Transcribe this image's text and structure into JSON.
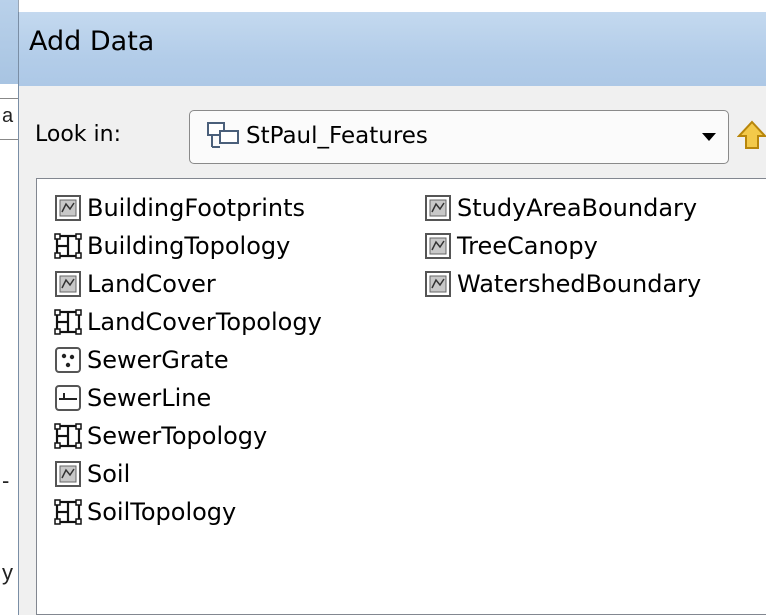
{
  "background_window": {
    "fragment_top": "a",
    "fragment_mid": "-",
    "fragment_bottom": "y"
  },
  "dialog": {
    "title": "Add Data",
    "look_in_label": "Look in:",
    "look_in_value": "StPaul_Features",
    "look_in_icon": "feature-dataset-icon"
  },
  "items": [
    {
      "label": "BuildingFootprints",
      "icon": "polygon-feature-class-icon"
    },
    {
      "label": "BuildingTopology",
      "icon": "topology-icon"
    },
    {
      "label": "LandCover",
      "icon": "polygon-feature-class-icon"
    },
    {
      "label": "LandCoverTopology",
      "icon": "topology-icon"
    },
    {
      "label": "SewerGrate",
      "icon": "point-feature-class-icon"
    },
    {
      "label": "SewerLine",
      "icon": "line-feature-class-icon"
    },
    {
      "label": "SewerTopology",
      "icon": "topology-icon"
    },
    {
      "label": "Soil",
      "icon": "polygon-feature-class-icon"
    },
    {
      "label": "SoilTopology",
      "icon": "topology-icon"
    },
    {
      "label": "StudyAreaBoundary",
      "icon": "polygon-feature-class-icon"
    },
    {
      "label": "TreeCanopy",
      "icon": "polygon-feature-class-icon"
    },
    {
      "label": "WatershedBoundary",
      "icon": "polygon-feature-class-icon"
    }
  ]
}
